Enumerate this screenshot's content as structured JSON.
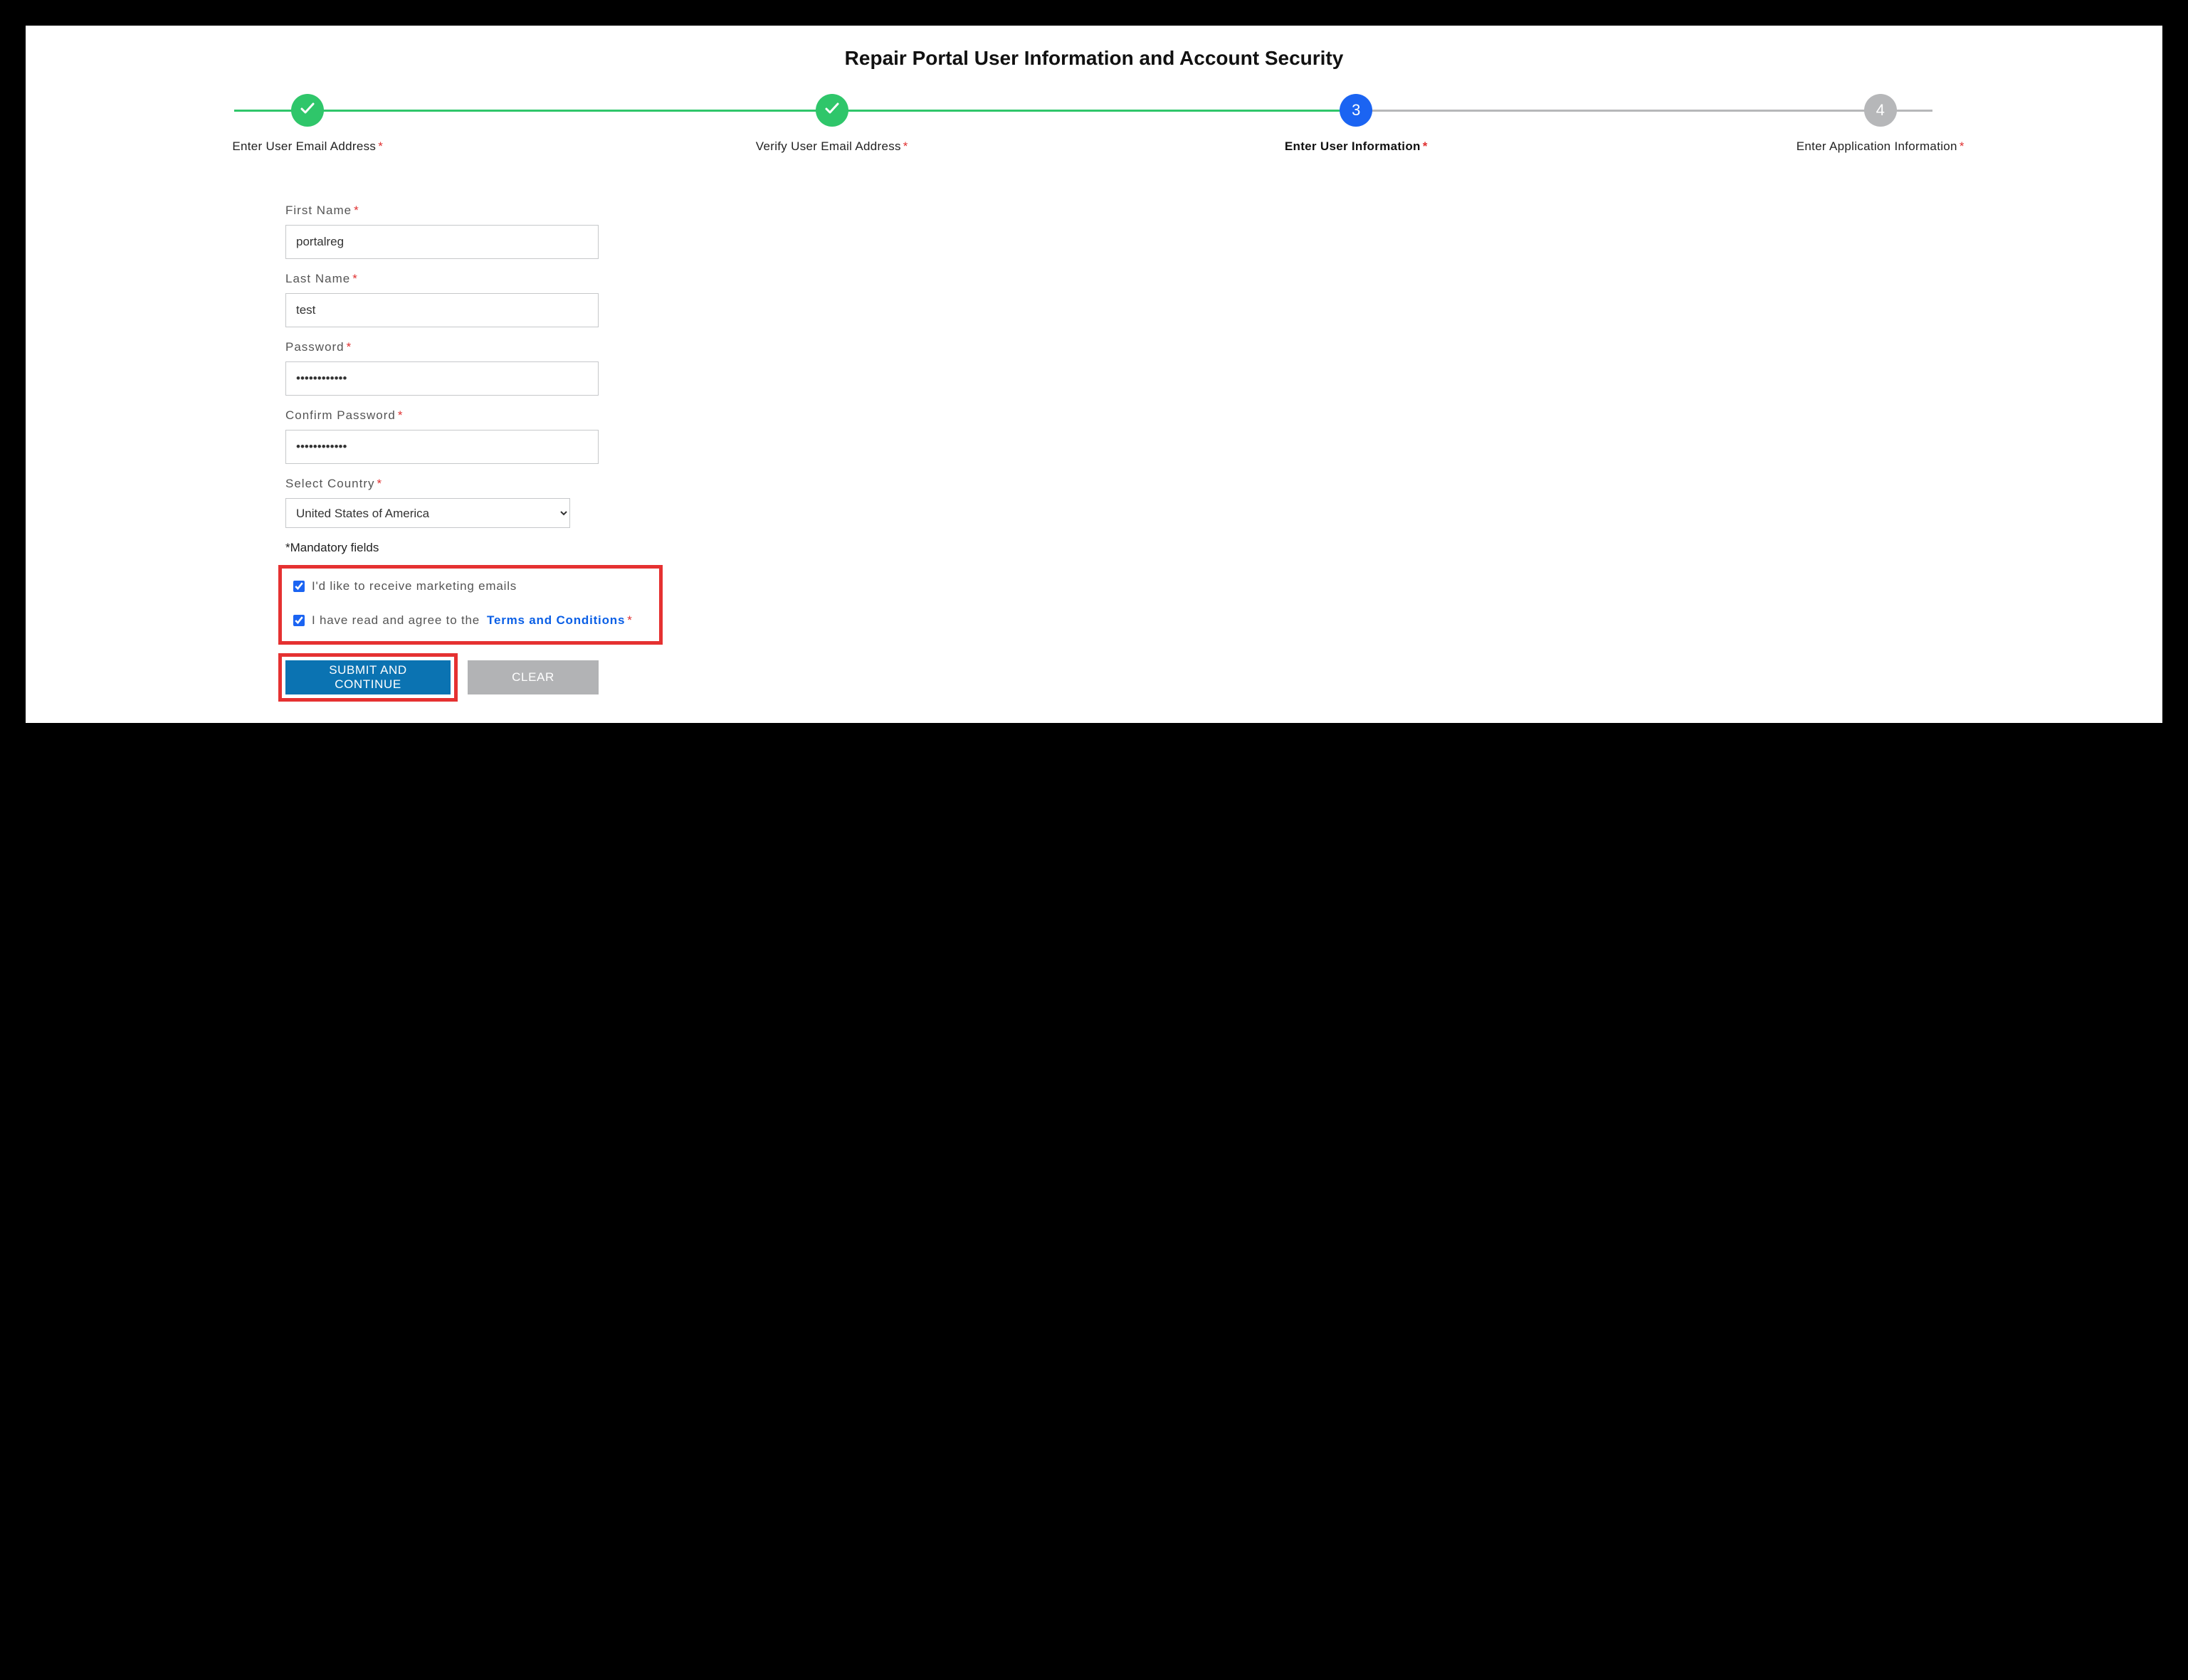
{
  "title": "Repair Portal User Information and Account Security",
  "steps": [
    {
      "label": "Enter User Email Address",
      "state": "done",
      "number": "1"
    },
    {
      "label": "Verify User Email Address",
      "state": "done",
      "number": "2"
    },
    {
      "label": "Enter User Information",
      "state": "active",
      "number": "3"
    },
    {
      "label": "Enter Application Information",
      "state": "pending",
      "number": "4"
    }
  ],
  "form": {
    "first_name": {
      "label": "First Name",
      "value": "portalreg"
    },
    "last_name": {
      "label": "Last Name",
      "value": "test"
    },
    "password": {
      "label": "Password",
      "value": "••••••••••••"
    },
    "confirm_password": {
      "label": "Confirm Password",
      "value": "••••••••••••"
    },
    "country": {
      "label": "Select Country",
      "value": "United States of America"
    },
    "mandatory_note": "*Mandatory fields",
    "marketing_opt_in": {
      "label": "I'd like to receive marketing emails",
      "checked": true
    },
    "terms": {
      "prefix": "I have read and agree to the",
      "link": "Terms and Conditions",
      "checked": true
    }
  },
  "buttons": {
    "submit": "SUBMIT AND CONTINUE",
    "clear": "CLEAR"
  }
}
